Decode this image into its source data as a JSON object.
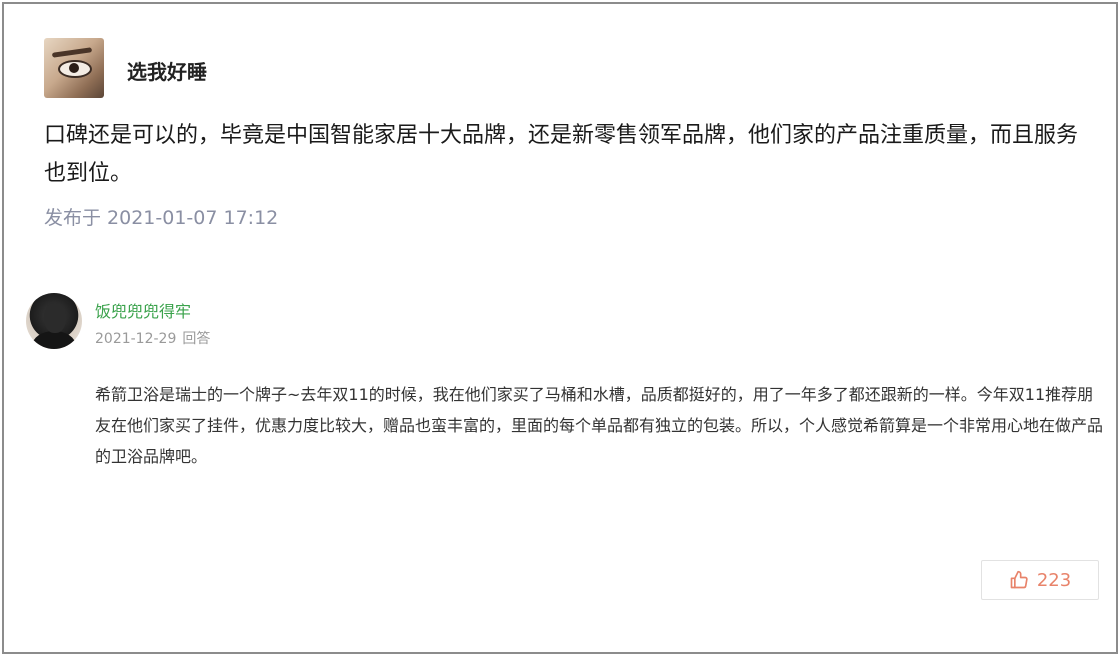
{
  "post": {
    "author": "选我好睡",
    "body": "口碑还是可以的，毕竟是中国智能家居十大品牌，还是新零售领军品牌，他们家的产品注重质量，而且服务也到位。",
    "published": "发布于 2021-01-07 17:12"
  },
  "comment": {
    "author": "饭兜兜兜得牢",
    "date": "2021-12-29",
    "reply_label": "回答",
    "body": "希箭卫浴是瑞士的一个牌子~去年双11的时候，我在他们家买了马桶和水槽，品质都挺好的，用了一年多了都还跟新的一样。今年双11推荐朋友在他们家买了挂件，优惠力度比较大，赠品也蛮丰富的，里面的每个单品都有独立的包装。所以，个人感觉希箭算是一个非常用心地在做产品的卫浴品牌吧。",
    "like_count": "223",
    "like_icon": "thumbs-up-icon",
    "accent_color": "#e8836a",
    "author_color": "#3aa24b"
  }
}
